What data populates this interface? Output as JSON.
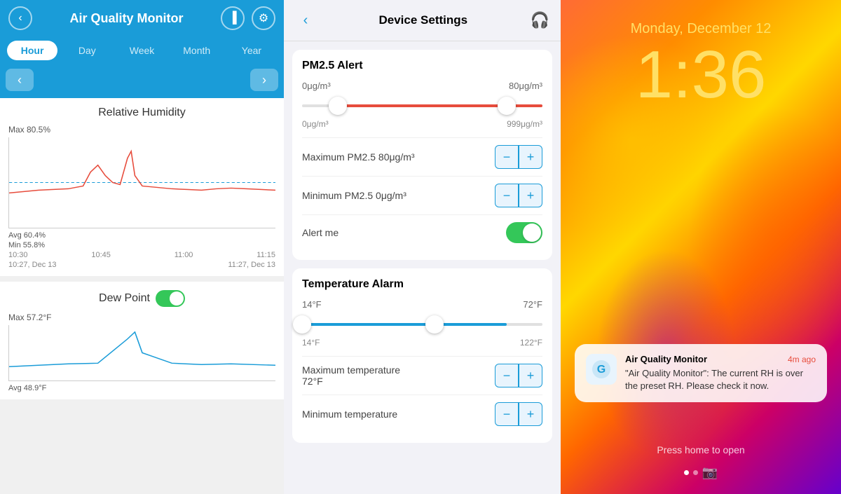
{
  "panel_aq": {
    "title": "Air Quality Monitor",
    "tabs": [
      "Hour",
      "Day",
      "Week",
      "Month",
      "Year"
    ],
    "active_tab": "Hour",
    "back_label": "‹",
    "nav_prev": "‹",
    "nav_next": "›",
    "humidity": {
      "title": "Relative Humidity",
      "max": "Max 80.5%",
      "avg": "Avg 60.4%",
      "min": "Min 55.8%",
      "x_labels": [
        "10:30",
        "10:45",
        "11:00",
        "11:15"
      ],
      "date_start": "10:27,  Dec 13",
      "date_end": "11:27, Dec 13"
    },
    "dew_point": {
      "title": "Dew Point",
      "toggle_on": true,
      "max": "Max 57.2°F",
      "avg": "Avg 48.9°F"
    }
  },
  "panel_settings": {
    "title": "Device Settings",
    "back_label": "‹",
    "pm25": {
      "title": "PM2.5 Alert",
      "range_min_label": "0μg/m³",
      "range_max_label": "80μg/m³",
      "range_start": "0μg/m³",
      "range_end": "999μg/m³",
      "max_label": "Maximum PM2.5",
      "max_value": "80μg/m³",
      "min_label": "Minimum PM2.5",
      "min_value": "0μg/m³",
      "alert_label": "Alert me",
      "alert_on": true
    },
    "temp": {
      "title": "Temperature Alarm",
      "range_min_label": "14°F",
      "range_max_label": "72°F",
      "range_start": "14°F",
      "range_end": "122°F",
      "max_label": "Maximum temperature\n72°F",
      "min_label": "Minimum temperature"
    }
  },
  "panel_lock": {
    "date": "Monday, December 12",
    "time": "1:36",
    "notification": {
      "app_name": "Air Quality Monitor",
      "time_ago": "4m ago",
      "text": "\"Air Quality Monitor\": The current RH is over the preset RH. Please check it now.",
      "app_icon": "G"
    },
    "press_home": "Press home to open"
  }
}
